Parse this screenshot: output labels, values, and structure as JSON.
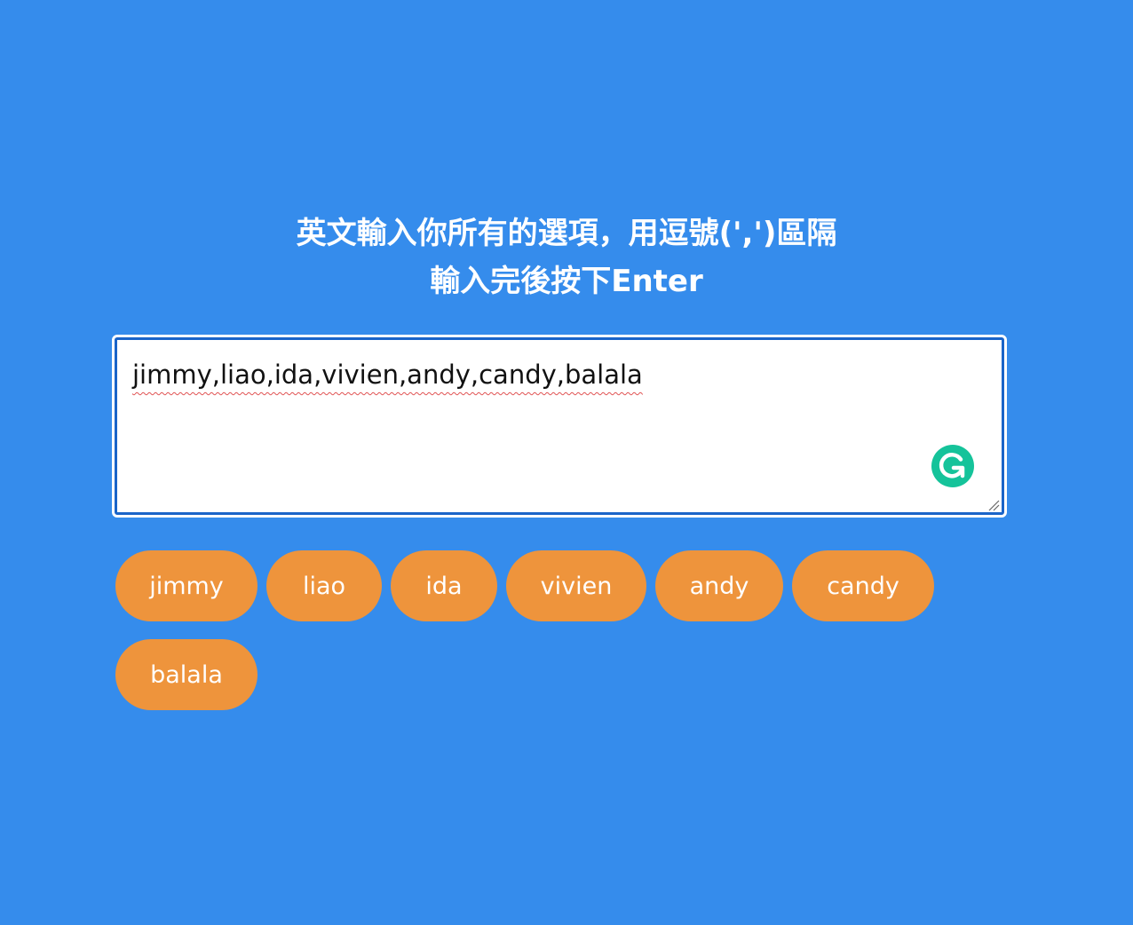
{
  "heading": {
    "line1": "英文輸入你所有的選項，用逗號(',')區隔",
    "line2": "輸入完後按下Enter"
  },
  "input": {
    "value": "jimmy,liao,ida,vivien,andy,candy,balala"
  },
  "tags": [
    "jimmy",
    "liao",
    "ida",
    "vivien",
    "andy",
    "candy",
    "balala"
  ],
  "colors": {
    "background": "#358cec",
    "tag": "#ee943c",
    "focus_border": "#1a64c8",
    "grammar_icon": "#15c39a"
  }
}
